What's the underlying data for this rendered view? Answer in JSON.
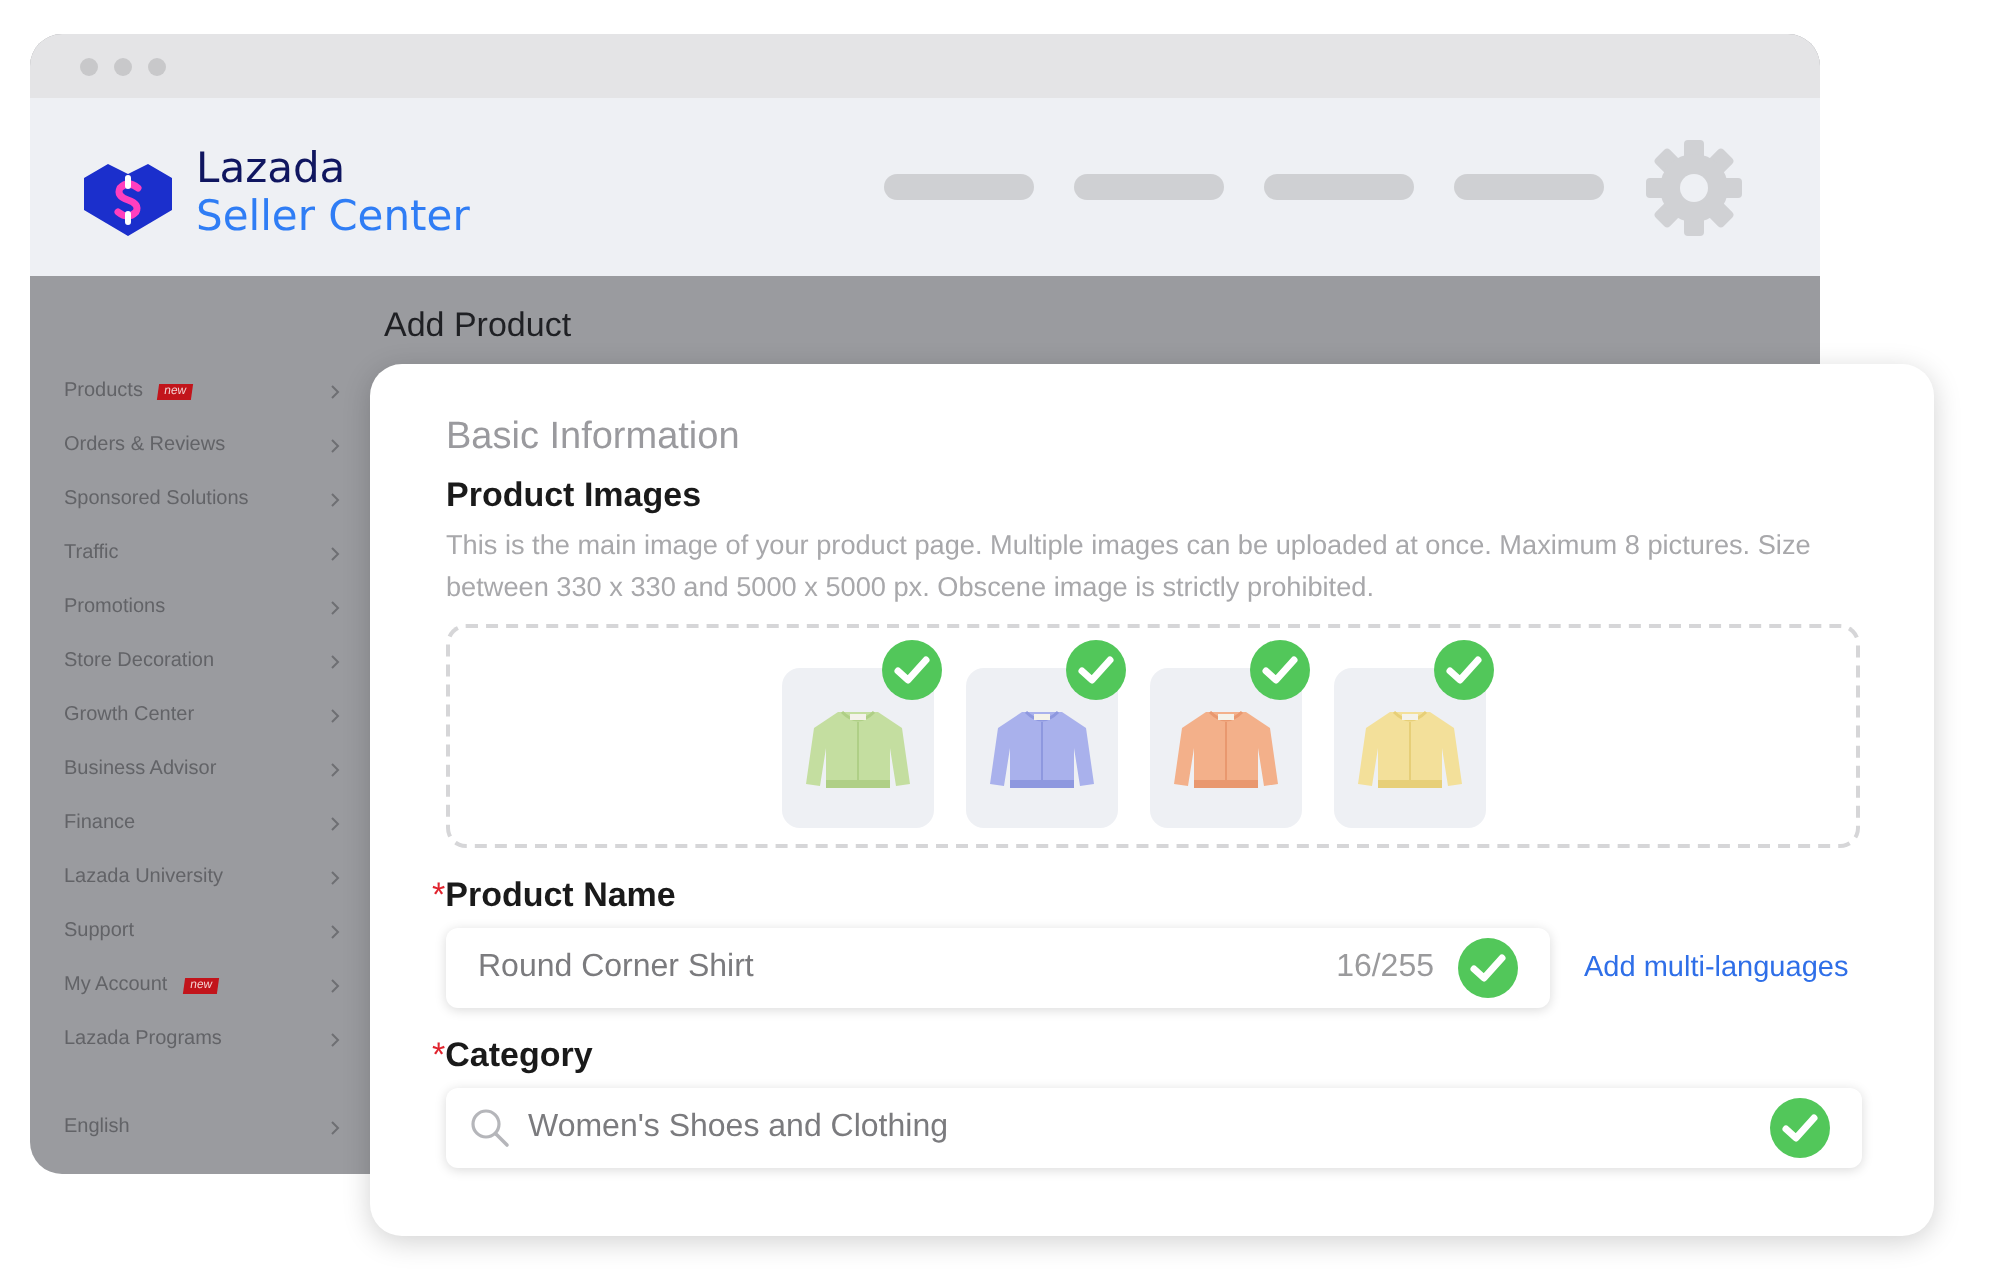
{
  "logo": {
    "brand": "Lazada",
    "product": "Seller Center"
  },
  "sidebar": {
    "items": [
      {
        "label": "Products",
        "badge": "new"
      },
      {
        "label": "Orders & Reviews"
      },
      {
        "label": "Sponsored Solutions"
      },
      {
        "label": "Traffic"
      },
      {
        "label": "Promotions"
      },
      {
        "label": "Store Decoration"
      },
      {
        "label": "Growth Center"
      },
      {
        "label": "Business Advisor"
      },
      {
        "label": "Finance"
      },
      {
        "label": "Lazada University"
      },
      {
        "label": "Support"
      },
      {
        "label": "My Account",
        "badge": "new"
      },
      {
        "label": "Lazada Programs"
      }
    ],
    "footer": "English"
  },
  "page_title": "Add Product",
  "card": {
    "section_title": "Basic Information",
    "images": {
      "label": "Product Images",
      "description": "This is the main image of your product page. Multiple images can be uploaded at once. Maximum 8 pictures. Size between 330 x 330 and 5000 x 5000 px. Obscene image is strictly prohibited.",
      "items": [
        {
          "kind": "picture",
          "checked": true
        },
        {
          "kind": "picture",
          "checked": true
        },
        {
          "kind": "picture",
          "checked": true
        },
        {
          "kind": "picture",
          "checked": true
        }
      ]
    },
    "product_name": {
      "label": "Product Name",
      "required": true,
      "required_mark": "*",
      "value": "Round Corner Shirt",
      "counter": "16/255",
      "valid": true,
      "link": "Add multi-languages"
    },
    "category": {
      "label": "Category",
      "required": true,
      "required_mark": "*",
      "value": "Women's Shoes and Clothing",
      "valid": true
    }
  }
}
